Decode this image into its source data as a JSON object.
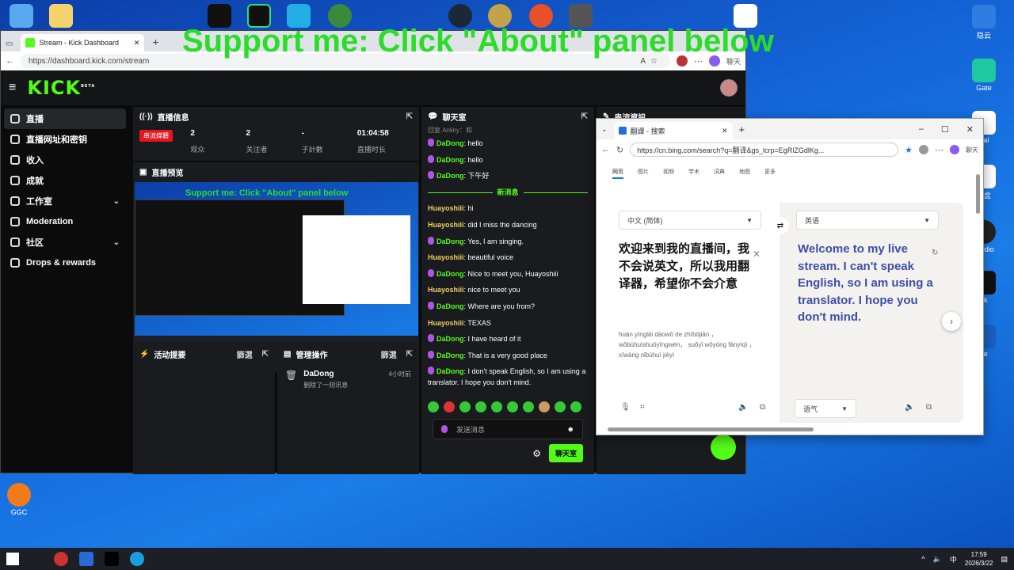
{
  "overlay_text": "Support me: Click \"About\" panel below",
  "kick_window": {
    "tab_title": "Stream - Kick Dashboard",
    "url": "https://dashboard.kick.com/stream",
    "profile_label": "聊天",
    "logo": "KICK",
    "logo_badge": "BETA",
    "nav": [
      {
        "label": "直播",
        "icon": "broadcast-icon"
      },
      {
        "label": "直播网址和密钥",
        "icon": "link-icon"
      },
      {
        "label": "收入",
        "icon": "money-icon"
      },
      {
        "label": "成就",
        "icon": "trophy-icon"
      },
      {
        "label": "工作室",
        "icon": "studio-icon"
      },
      {
        "label": "Moderation",
        "icon": "wrench-icon"
      },
      {
        "label": "社区",
        "icon": "community-icon"
      },
      {
        "label": "Drops & rewards",
        "icon": "gift-icon"
      }
    ],
    "stream_info": {
      "title": "直播信息",
      "badge": "串流媒體",
      "stats": [
        {
          "value": "2",
          "label": "观众"
        },
        {
          "value": "2",
          "label": "关注者"
        },
        {
          "value": "-",
          "label": "子計數"
        },
        {
          "value": "01:04:58",
          "label": "直播时长"
        }
      ]
    },
    "preview": {
      "title": "直播预览",
      "mini_overlay": "Support me: Click \"About\" panel below"
    },
    "activity": {
      "title": "活动提要",
      "filter": "篩選"
    },
    "mod": {
      "title": "管理操作",
      "filter": "篩選",
      "user": "DaDong",
      "time": "4小时前",
      "action": "删除了一则讯息"
    },
    "stream_settings_title": "串流資訊",
    "chat": {
      "title": "聊天室",
      "reply": "回复 Anliny：和",
      "pre": [
        {
          "user": "DaDong",
          "text": "hello"
        },
        {
          "user": "DaDong",
          "text": "hello"
        },
        {
          "user": "DaDong",
          "text": "下午好"
        }
      ],
      "new_label": "新消息",
      "messages": [
        {
          "user": "Huayoshiii",
          "text": "hi"
        },
        {
          "user": "Huayoshiii",
          "text": "did I miss the dancing"
        },
        {
          "user": "DaDong",
          "text": "Yes, I am singing."
        },
        {
          "user": "Huayoshiii",
          "text": "beautiful voice"
        },
        {
          "user": "DaDong",
          "text": "Nice to meet you, Huayoshiii"
        },
        {
          "user": "Huayoshiii",
          "text": "nice to meet you"
        },
        {
          "user": "DaDong",
          "text": "Where are you from?"
        },
        {
          "user": "Huayoshiii",
          "text": "TEXAS"
        },
        {
          "user": "DaDong",
          "text": "I have heard of it"
        },
        {
          "user": "DaDong",
          "text": "That is a very good place"
        },
        {
          "user": "DaDong",
          "text": "I don't speak English, so I am using a translator. I hope you don't mind."
        }
      ],
      "input_placeholder": "发送消息",
      "send_button": "聊天室"
    }
  },
  "bing_window": {
    "tab_title": "翻譯 - 搜索",
    "url": "https://cn.bing.com/search?q=翻译&gs_lcrp=EgRlZGdlKg...",
    "profile_label": "聊天",
    "nav": [
      "网页",
      "图片",
      "视频",
      "学术",
      "词典",
      "地图",
      "更多"
    ],
    "source_lang": "中文 (简体)",
    "target_lang": "英语",
    "source_text": "欢迎来到我的直播间，我不会说英文，所以我用翻译器，希望你不会介意",
    "pinyin": "huān yínglái dàowǒ de zhíbōjiān ， wǒbùhuìshuōyīngwén， suǒyǐ wǒyòng fānyìqì ， xīwàng nǐbúhuì jièyì",
    "target_text": "Welcome to my live stream. I can't speak English, so I am using a translator. I hope you don't mind.",
    "tone": "语气"
  },
  "desktop": {
    "icons_left": [
      {
        "label": "GGC"
      }
    ],
    "icons_right": [
      {
        "label": "隐云"
      },
      {
        "label": "Gate"
      },
      {
        "label": "Pal"
      },
      {
        "label": "黑盒"
      },
      {
        "label": "Studio"
      },
      {
        "label": "ck"
      },
      {
        "label": "ve"
      }
    ]
  },
  "taskbar": {
    "time": "17:59",
    "date": "2026/3/22",
    "ime": "中"
  }
}
